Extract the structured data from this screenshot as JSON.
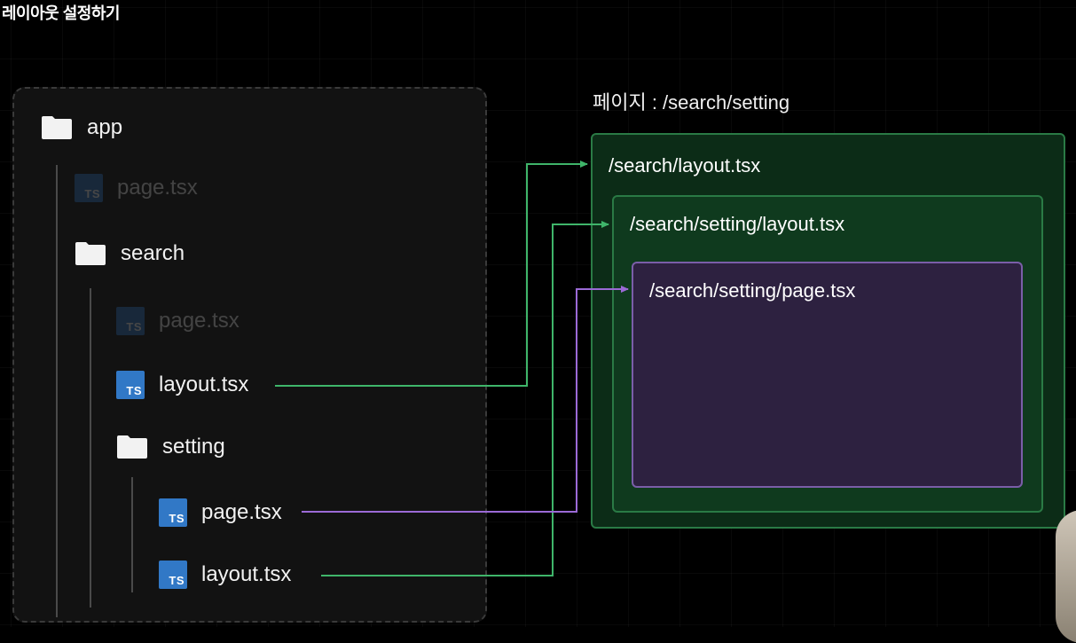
{
  "title": "레이아웃 설정하기",
  "page_label": "페이지 : /search/setting",
  "tree": {
    "app": "app",
    "app_page": "page.tsx",
    "search": "search",
    "search_page": "page.tsx",
    "search_layout": "layout.tsx",
    "setting": "setting",
    "setting_page": "page.tsx",
    "setting_layout": "layout.tsx",
    "ts_badge": "TS"
  },
  "boxes": {
    "outer": "/search/layout.tsx",
    "middle": "/search/setting/layout.tsx",
    "inner": "/search/setting/page.tsx"
  },
  "colors": {
    "layout_connector": "#3fb56a",
    "page_connector": "#9b6ad6",
    "ts_blue": "#3178c6"
  },
  "icons": [
    "folder-icon",
    "ts-file-icon",
    "arrow-icon"
  ]
}
